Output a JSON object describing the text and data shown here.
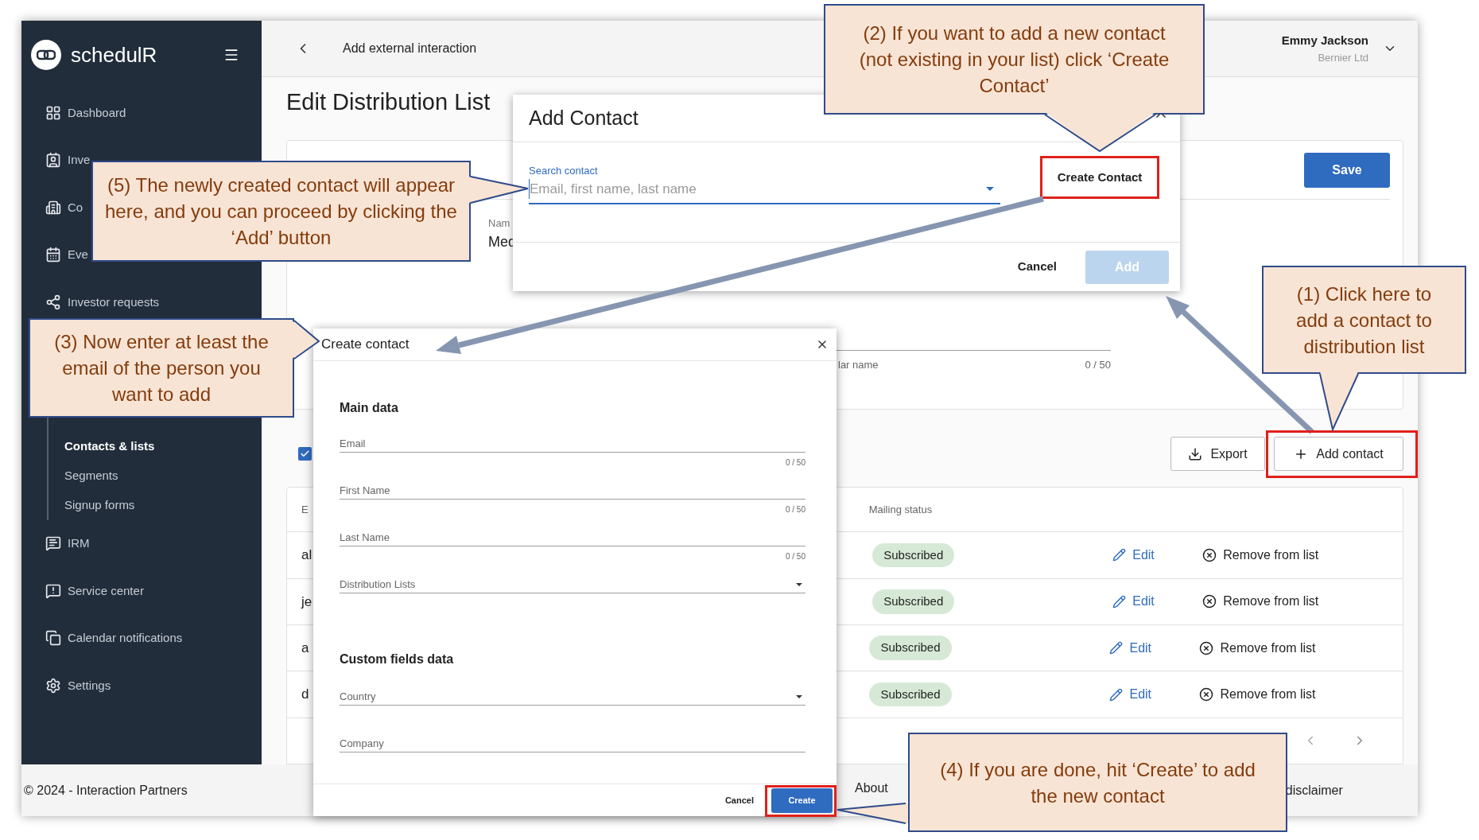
{
  "sidebar": {
    "brand": "schedulR",
    "items": [
      {
        "label": "Dashboard",
        "selected": false
      },
      {
        "label": "Inve",
        "selected": false
      },
      {
        "label": "Co",
        "selected": false
      },
      {
        "label": "Eve",
        "selected": false
      },
      {
        "label": "Investor requests",
        "selected": false
      }
    ],
    "sub_items": [
      {
        "label": "Contacts & lists",
        "selected": true
      },
      {
        "label": "Segments",
        "selected": false
      },
      {
        "label": "Signup forms",
        "selected": false
      }
    ],
    "items_2": [
      {
        "label": "IRM",
        "selected": false
      },
      {
        "label": "Service center",
        "selected": false
      },
      {
        "label": "Calendar notifications",
        "selected": false
      },
      {
        "label": "Settings",
        "selected": false
      }
    ]
  },
  "top_bar": {
    "title": "Add external interaction",
    "user": {
      "name": "Emmy Jackson",
      "company": "Bernier Ltd"
    }
  },
  "page": {
    "title": "Edit Distribution List",
    "save_button": "Save",
    "name_field": {
      "label": "Nam",
      "value": "Med"
    },
    "field_2": {
      "label": "lar name",
      "counter": "0 / 50"
    },
    "select_all": {
      "checked": true
    },
    "export_button": "Export",
    "add_button": "Add contact",
    "table": {
      "columns": [
        "E",
        "Mailing status"
      ],
      "rows": [
        {
          "email": "al",
          "status": "Subscribed",
          "edit": "Edit",
          "remove": "Remove from list"
        },
        {
          "email": "je",
          "status": "Subscribed",
          "edit": "Edit",
          "remove": "Remove from list"
        },
        {
          "email": "a",
          "status": "Subscribed",
          "edit": "Edit",
          "remove": "Remove from list"
        },
        {
          "email": "d",
          "status": "Subscribed",
          "edit": "Edit",
          "remove": "Remove from list"
        }
      ]
    }
  },
  "footer": {
    "copyright": "© 2024 - Interaction Partners",
    "links": [
      "About",
      "disclaimer"
    ]
  },
  "add_contact_dialog": {
    "title": "Add Contact",
    "search": {
      "label": "Search contact",
      "placeholder": "Email, first name, last name"
    },
    "create_button": "Create Contact",
    "cancel_button": "Cancel",
    "add_button": "Add",
    "add_disabled": true
  },
  "create_contact_dialog": {
    "title": "Create contact",
    "sections": [
      {
        "heading": "Main data",
        "fields": [
          {
            "label": "Email",
            "kind": "text",
            "counter": "0 / 50"
          },
          {
            "label": "First Name",
            "kind": "text",
            "counter": "0 / 50"
          },
          {
            "label": "Last Name",
            "kind": "text",
            "counter": "0 / 50"
          },
          {
            "label": "Distribution Lists",
            "kind": "select"
          }
        ]
      },
      {
        "heading": "Custom fields data",
        "fields": [
          {
            "label": "Country",
            "kind": "select"
          },
          {
            "label": "Company",
            "kind": "text"
          }
        ]
      }
    ],
    "cancel_button": "Cancel",
    "create_button": "Create"
  },
  "callouts": [
    {
      "text": "(1) Click here to add a contact to distribution list"
    },
    {
      "text": "(2) If you want to add a new contact (not existing in your list) click ‘Create Contact’"
    },
    {
      "text": "(3) Now enter at least the email of the person you want to add"
    },
    {
      "text": "(4) If you are done, hit ‘Create’ to add the new contact"
    },
    {
      "text": "(5) The newly created contact will appear here, and you can proceed by clicking the ‘Add’ button"
    }
  ]
}
